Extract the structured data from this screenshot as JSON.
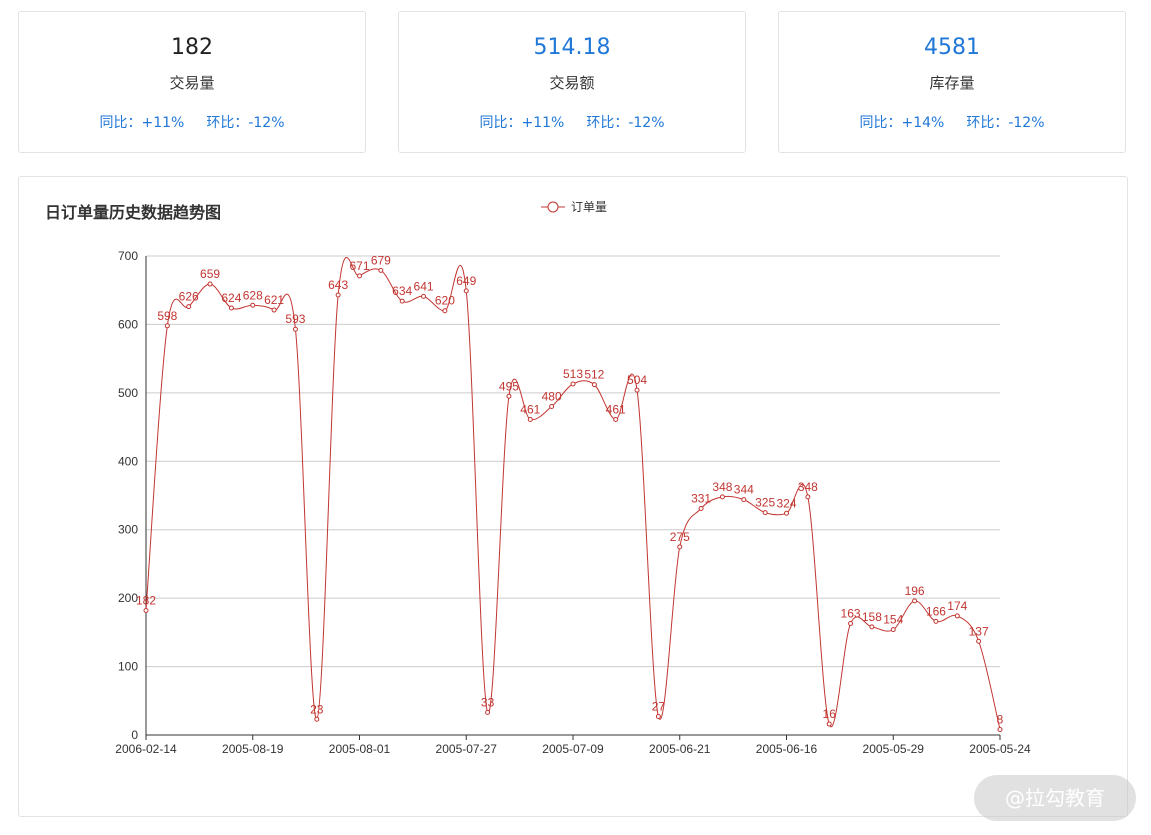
{
  "stats": [
    {
      "value": "182",
      "label": "交易量",
      "yoy": "同比：+11%",
      "mom": "环比：-12%",
      "value_color": "#222222"
    },
    {
      "value": "514.18",
      "label": "交易额",
      "yoy": "同比：+11%",
      "mom": "环比：-12%",
      "value_color": "#1f77d8"
    },
    {
      "value": "4581",
      "label": "库存量",
      "yoy": "同比：+14%",
      "mom": "环比：-12%",
      "value_color": "#1f77d8"
    }
  ],
  "chart_title": "日订单量历史数据趋势图",
  "watermark": "@拉勾教育",
  "chart_data": {
    "type": "line",
    "title": "日订单量历史数据趋势图",
    "series": [
      {
        "name": "订单量",
        "color": "#c23531",
        "values": [
          182,
          598,
          626,
          659,
          624,
          628,
          621,
          593,
          23,
          643,
          671,
          679,
          634,
          641,
          620,
          649,
          33,
          495,
          461,
          480,
          513,
          512,
          461,
          504,
          27,
          275,
          331,
          348,
          344,
          325,
          324,
          348,
          16,
          163,
          158,
          154,
          196,
          166,
          174,
          137,
          8
        ]
      }
    ],
    "x_tick_labels": [
      "2006-02-14",
      "2005-08-19",
      "2005-08-01",
      "2005-07-27",
      "2005-07-09",
      "2005-06-21",
      "2005-06-16",
      "2005-05-29",
      "2005-05-24"
    ],
    "x_tick_step": 5,
    "ylim": [
      0,
      700
    ],
    "y_ticks": [
      0,
      100,
      200,
      300,
      400,
      500,
      600,
      700
    ],
    "grid": true,
    "legend_position": "top-center",
    "data_labels": true
  }
}
